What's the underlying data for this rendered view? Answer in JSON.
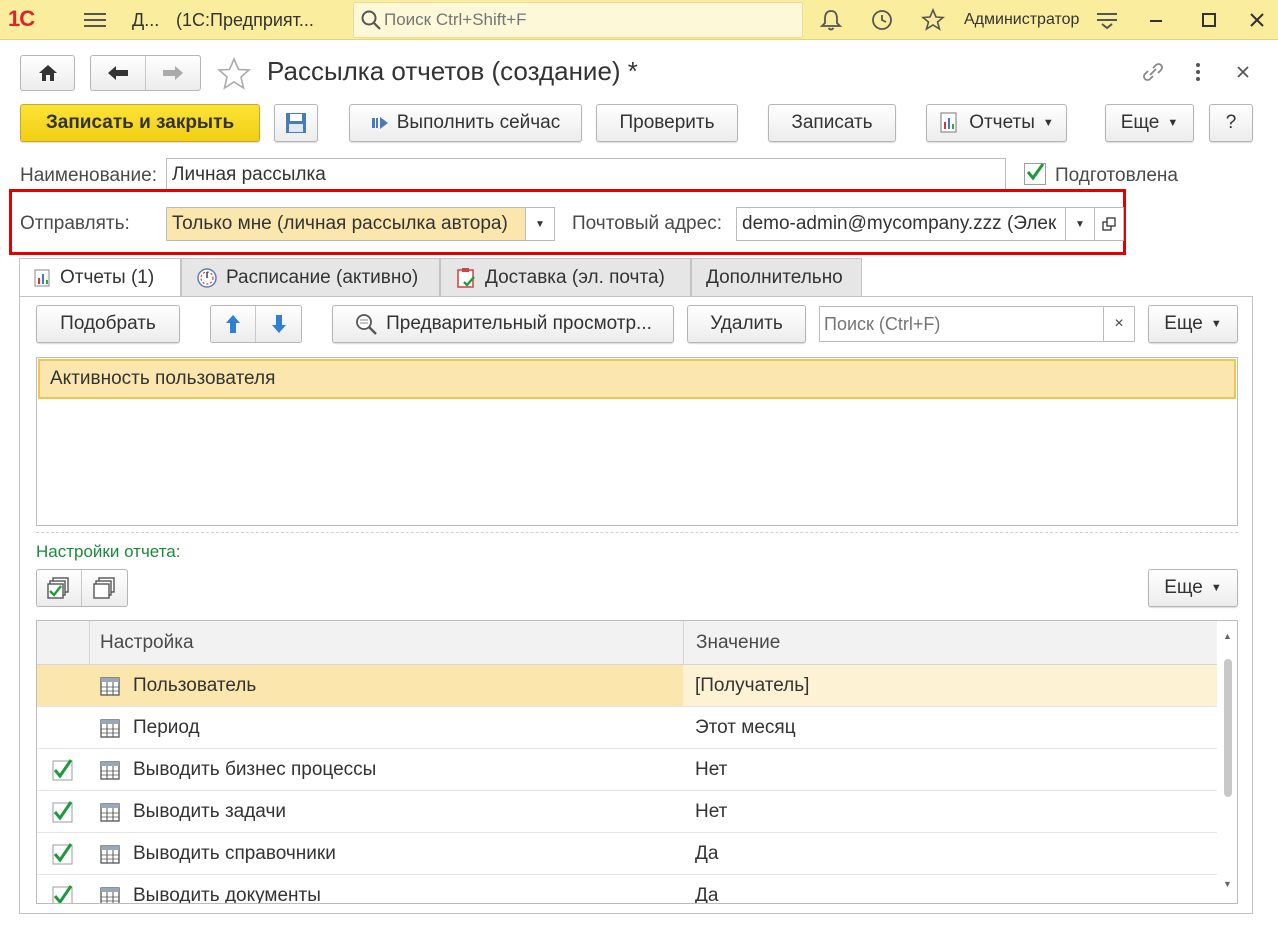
{
  "app": {
    "logo": "1С",
    "title_short": "Д...",
    "title_app": "(1С:Предприят...",
    "search_placeholder": "Поиск Ctrl+Shift+F",
    "user": "Администратор"
  },
  "form": {
    "title": "Рассылка отчетов (создание) *",
    "toolbar": {
      "save_close": "Записать и закрыть",
      "run_now": "Выполнить сейчас",
      "check": "Проверить",
      "write": "Записать",
      "reports": "Отчеты",
      "more": "Еще",
      "help": "?"
    },
    "name_label": "Наименование:",
    "name_value": "Личная рассылка",
    "prepared_label": "Подготовлена",
    "prepared_checked": true,
    "send_label": "Отправлять:",
    "send_value": "Только мне (личная рассылка автора)",
    "email_label": "Почтовый адрес:",
    "email_value": "demo-admin@mycompany.zzz (Элек",
    "highlight_color": "#e50000"
  },
  "tabs": [
    {
      "label": "Отчеты (1)",
      "active": true
    },
    {
      "label": "Расписание (активно)",
      "active": false
    },
    {
      "label": "Доставка (эл. почта)",
      "active": false
    },
    {
      "label": "Дополнительно",
      "active": false
    }
  ],
  "reports_tab": {
    "pick": "Подобрать",
    "preview": "Предварительный просмотр...",
    "delete": "Удалить",
    "search_placeholder": "Поиск (Ctrl+F)",
    "more": "Еще",
    "clear_glyph": "×",
    "reports": [
      "Активность пользователя"
    ],
    "settings_label": "Настройки отчета:",
    "settings_more": "Еще",
    "columns": {
      "setting": "Настройка",
      "value": "Значение"
    },
    "rows": [
      {
        "checked": false,
        "name": "Пользователь",
        "value": "[Получатель]",
        "selected": true
      },
      {
        "checked": false,
        "name": "Период",
        "value": "Этот месяц",
        "selected": false
      },
      {
        "checked": true,
        "name": "Выводить бизнес процессы",
        "value": "Нет",
        "selected": false
      },
      {
        "checked": true,
        "name": "Выводить задачи",
        "value": "Нет",
        "selected": false
      },
      {
        "checked": true,
        "name": "Выводить справочники",
        "value": "Да",
        "selected": false
      },
      {
        "checked": true,
        "name": "Выводить документы",
        "value": "Да",
        "selected": false
      }
    ]
  }
}
